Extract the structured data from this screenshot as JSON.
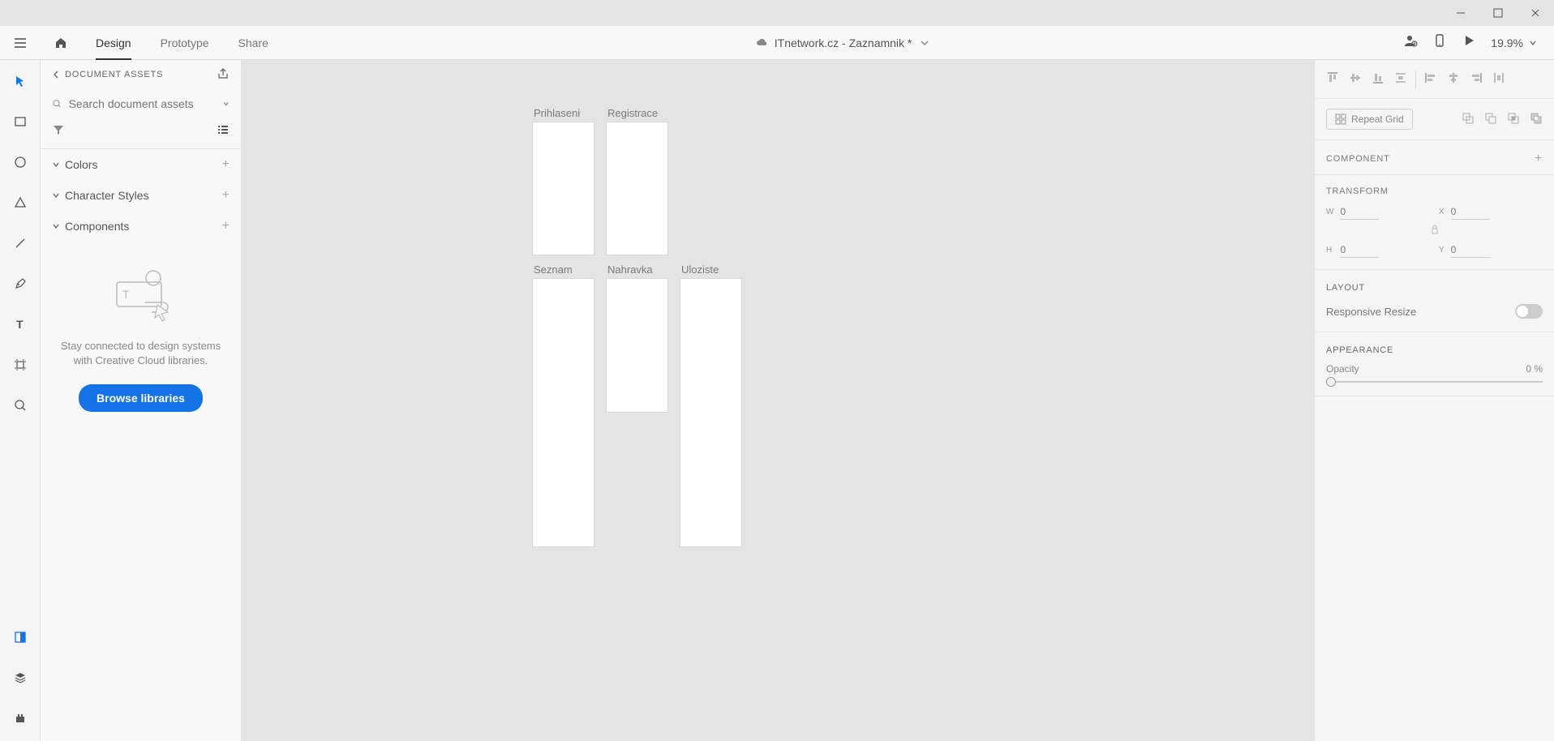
{
  "window": {
    "minimize": "—",
    "maximize": "☐",
    "close": "✕"
  },
  "tabs": {
    "design": "Design",
    "prototype": "Prototype",
    "share": "Share"
  },
  "doc_title": "ITnetwork.cz - Zaznamnik *",
  "zoom": "19.9%",
  "assets": {
    "header": "DOCUMENT ASSETS",
    "search_placeholder": "Search document assets",
    "sections": {
      "colors": "Colors",
      "char_styles": "Character Styles",
      "components": "Components"
    },
    "empty_text": "Stay connected to design systems with Creative Cloud libraries.",
    "browse": "Browse libraries"
  },
  "artboards": {
    "prihlaseni": "Prihlaseni",
    "registrace": "Registrace",
    "seznam": "Seznam",
    "nahravka": "Nahravka",
    "uloziste": "Uloziste"
  },
  "inspector": {
    "repeat_grid": "Repeat Grid",
    "component": "COMPONENT",
    "transform": "TRANSFORM",
    "w_lbl": "W",
    "w_val": "0",
    "x_lbl": "X",
    "x_val": "0",
    "h_lbl": "H",
    "h_val": "0",
    "y_lbl": "Y",
    "y_val": "0",
    "layout": "LAYOUT",
    "responsive": "Responsive Resize",
    "appearance": "APPEARANCE",
    "opacity": "Opacity",
    "opacity_val": "0 %"
  }
}
